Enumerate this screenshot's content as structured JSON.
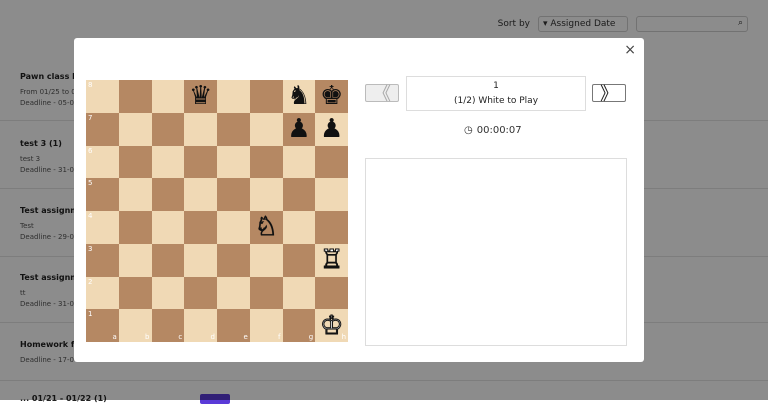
{
  "background": {
    "sort_label": "Sort by",
    "sort_value": "Assigned Date",
    "search_placeholder": "",
    "items": [
      {
        "title": "Pawn class ho",
        "line1": "From 01/25 to 0",
        "line2": "Deadline - 05-0"
      },
      {
        "title": "test 3    (1)",
        "line1": "test 3",
        "line2": "Deadline - 31-0"
      },
      {
        "title": "Test assignm",
        "line1": "Test",
        "line2": "Deadline - 29-0"
      },
      {
        "title": "Test assignm",
        "line1": "tt",
        "line2": "Deadline - 31-0"
      },
      {
        "title": "Homework fo",
        "line1": "",
        "line2": "Deadline - 17-0"
      }
    ],
    "bottom_text": "...   01/21 - 01/22   (1)"
  },
  "modal": {
    "close_label": "×",
    "move_number": "1",
    "move_status": "(1/2) White to Play",
    "timer": "00:00:07",
    "prev_label": "《",
    "next_label": "》",
    "ranks": [
      "8",
      "7",
      "6",
      "5",
      "4",
      "3",
      "2",
      "1"
    ],
    "files": [
      "a",
      "b",
      "c",
      "d",
      "e",
      "f",
      "g",
      "h"
    ],
    "pieces": [
      {
        "square": "d8",
        "glyph": "♛",
        "color": "black",
        "name": "black-queen-icon"
      },
      {
        "square": "g8",
        "glyph": "♞",
        "color": "black",
        "name": "black-knight-icon"
      },
      {
        "square": "h8",
        "glyph": "♚",
        "color": "black",
        "name": "black-king-icon"
      },
      {
        "square": "g7",
        "glyph": "♟",
        "color": "black",
        "name": "black-pawn-icon"
      },
      {
        "square": "h7",
        "glyph": "♟",
        "color": "black",
        "name": "black-pawn-icon"
      },
      {
        "square": "f4",
        "glyph": "♘",
        "color": "white",
        "name": "white-knight-icon"
      },
      {
        "square": "h3",
        "glyph": "♖",
        "color": "white",
        "name": "white-rook-icon"
      },
      {
        "square": "h1",
        "glyph": "♔",
        "color": "white",
        "name": "white-king-icon"
      }
    ],
    "colors": {
      "light_square": "#f0d9b5",
      "dark_square": "#b58863"
    }
  }
}
